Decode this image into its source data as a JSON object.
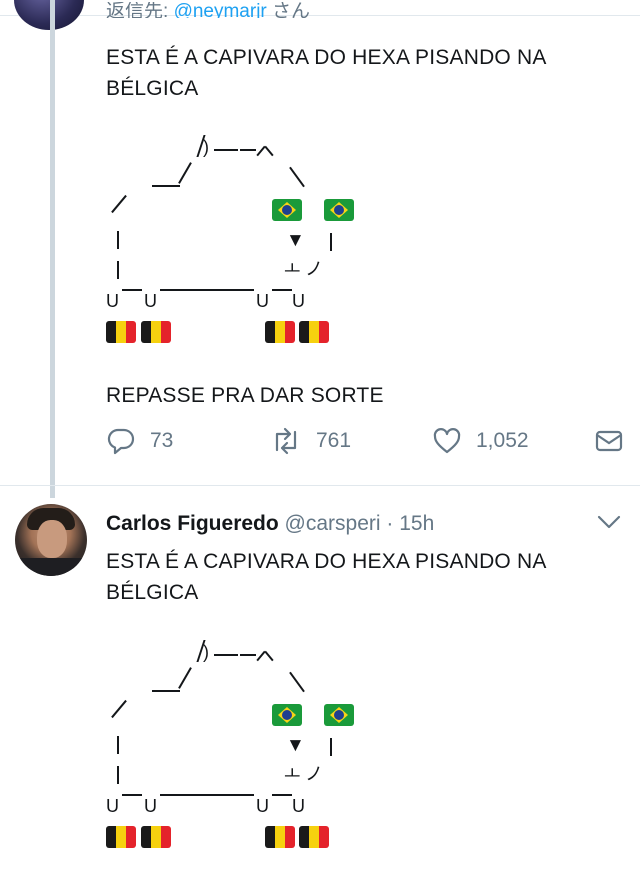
{
  "tweet1": {
    "reply_prefix": "返信先:",
    "reply_handle": "@neymarjr",
    "reply_suffix": "さん",
    "text_line1": "ESTA É A CAPIVARA DO HEXA PISANDO NA",
    "text_line2": "BÉLGICA",
    "text_footer": "REPASSE PRA DAR SORTE",
    "actions": {
      "reply_icon": "reply-icon",
      "reply_count": "73",
      "retweet_icon": "retweet-icon",
      "retweet_count": "761",
      "like_icon": "heart-icon",
      "like_count": "1,052",
      "dm_icon": "envelope-icon"
    }
  },
  "tweet2": {
    "author_name": "Carlos Figueredo",
    "author_handle": "@carsperi",
    "separator": "·",
    "time": "15h",
    "text_line1": "ESTA É A CAPIVARA DO HEXA PISANDO NA",
    "text_line2": "BÉLGICA"
  },
  "ascii_art": {
    "flags": [
      "brazil-flag",
      "belgium-flag"
    ],
    "eye": "▼",
    "mouth": "ㅗ",
    "tail": "ノ",
    "foot": "U"
  },
  "colors": {
    "link": "#1da1f2",
    "muted": "#657786",
    "thread_line": "#ccd6dd"
  }
}
